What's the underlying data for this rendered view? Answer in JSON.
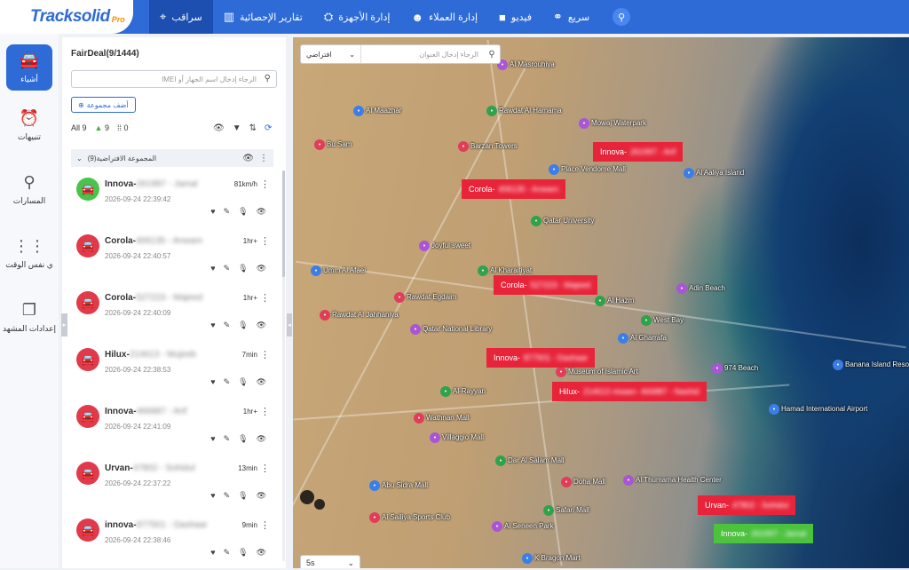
{
  "brand": {
    "name": "Tracksolid",
    "badge": "Pro"
  },
  "nav": [
    {
      "label": "سراقب",
      "icon": "location-pin-icon",
      "active": true
    },
    {
      "label": "تقارير الإحصائية",
      "icon": "bar-chart-icon",
      "active": false
    },
    {
      "label": "إدارة الأجهزة",
      "icon": "devices-icon",
      "active": false
    },
    {
      "label": "إدارة العملاء",
      "icon": "user-icon",
      "active": false
    },
    {
      "label": "فيديو",
      "icon": "video-icon",
      "active": false
    },
    {
      "label": "سريع",
      "icon": "link-icon",
      "active": false
    }
  ],
  "sidebar": [
    {
      "label": "أشياء",
      "icon": "car-icon",
      "active": true
    },
    {
      "label": "تنبيهات",
      "icon": "alarm-icon",
      "active": false
    },
    {
      "label": "المسارات",
      "icon": "route-pin-icon",
      "active": false
    },
    {
      "label": "ي نفس الوقت",
      "icon": "multi-screen-icon",
      "active": false
    },
    {
      "label": "إعدادات المشهد",
      "icon": "copy-icon",
      "active": false
    }
  ],
  "panel": {
    "title": "FairDeal(9/1444)",
    "search_placeholder": "الرجاء إدخال اسم الجهاز أو IMEI",
    "add_group": "أضف مجموعة",
    "filters": {
      "all": "All 9",
      "online": "9",
      "offline": "0"
    },
    "group_name": "المجموعة الافتراضية(9)"
  },
  "devices": [
    {
      "name": "Innova-",
      "hidden": "261997 - Jamal",
      "time": "2026-09-24 22:39:42",
      "status": "81km/h",
      "color": "green"
    },
    {
      "name": "Corola-",
      "hidden": "406135 - Anwam",
      "time": "2026-09-24 22:40:57",
      "status": "1hr+",
      "color": "red"
    },
    {
      "name": "Corola-",
      "hidden": "527223 - Majeed",
      "time": "2026-09-24 22:40:09",
      "status": "1hr+",
      "color": "red"
    },
    {
      "name": "Hilux-",
      "hidden": "214613 - Mujeeb",
      "time": "2026-09-24 22:38:53",
      "status": "7min",
      "color": "red"
    },
    {
      "name": "Innova-",
      "hidden": "466887 - Arif",
      "time": "2026-09-24 22:41:09",
      "status": "1hr+",
      "color": "red"
    },
    {
      "name": "Urvan-",
      "hidden": "47802 - Sohidul",
      "time": "2026-09-24 22:37:22",
      "status": "13min",
      "color": "red"
    },
    {
      "name": "innova-",
      "hidden": "877501 - Dashaar",
      "time": "2026-09-24 22:38:46",
      "status": "9min",
      "color": "red"
    }
  ],
  "map": {
    "type_select": "افتراضي",
    "search_placeholder": "الرجاء إدخال العنوان",
    "refresh_interval": "5s",
    "places": [
      "Al Masrouhiya",
      "Al Maazhar",
      "Rawdat Al Hamama",
      "Barzan Towers",
      "Mowaj Waterpark",
      "Place Vendome Mall",
      "Qatar University",
      "Bu Sam",
      "Joyful sweet",
      "Al Aaliya Island",
      "Al Kharaitiyat",
      "Rawdat Egdaim",
      "Adin Beach",
      "Umm Al Afaei",
      "Al Hazm",
      "Rawdat Al Jahhaniya",
      "Qatar National Library",
      "Al Gharrafa",
      "West Bay",
      "Museum of Islamic Art",
      "974 Beach",
      "Banana Island Resort Doha by Anantara",
      "Al-Rayyan",
      "Wathnan Mall",
      "Villaggio Mall",
      "Hamad International Airport",
      "Dar Al Salam Mall",
      "Doha Mall",
      "Al Thumama Health Center",
      "Abu Sidra Mall",
      "Safari Mall",
      "Al Sailiya Sports Club",
      "Al Seneen Park",
      "K Bragon Mart"
    ],
    "vehicles": [
      {
        "name": "Innova-",
        "hidden": "261997 - Arif",
        "color": "red"
      },
      {
        "name": "Corola-",
        "hidden": "406135 - Anwam",
        "color": "red"
      },
      {
        "name": "Corola-",
        "hidden": "527223 - Majeed",
        "color": "red"
      },
      {
        "name": "Innova-",
        "hidden": "877501 - Dashaar",
        "color": "red"
      },
      {
        "name": "Hilux-",
        "hidden": "214613 nisaan- 466887 - Nashid",
        "color": "red"
      },
      {
        "name": "Urvan-",
        "hidden": "47802 - Sohidul",
        "color": "red"
      },
      {
        "name": "Innova-",
        "hidden": "261997 - Jamal",
        "color": "green"
      }
    ]
  },
  "colors": {
    "brand_blue": "#2e6bd6",
    "offline_red": "#e13a4b",
    "online_green": "#48c34c"
  }
}
